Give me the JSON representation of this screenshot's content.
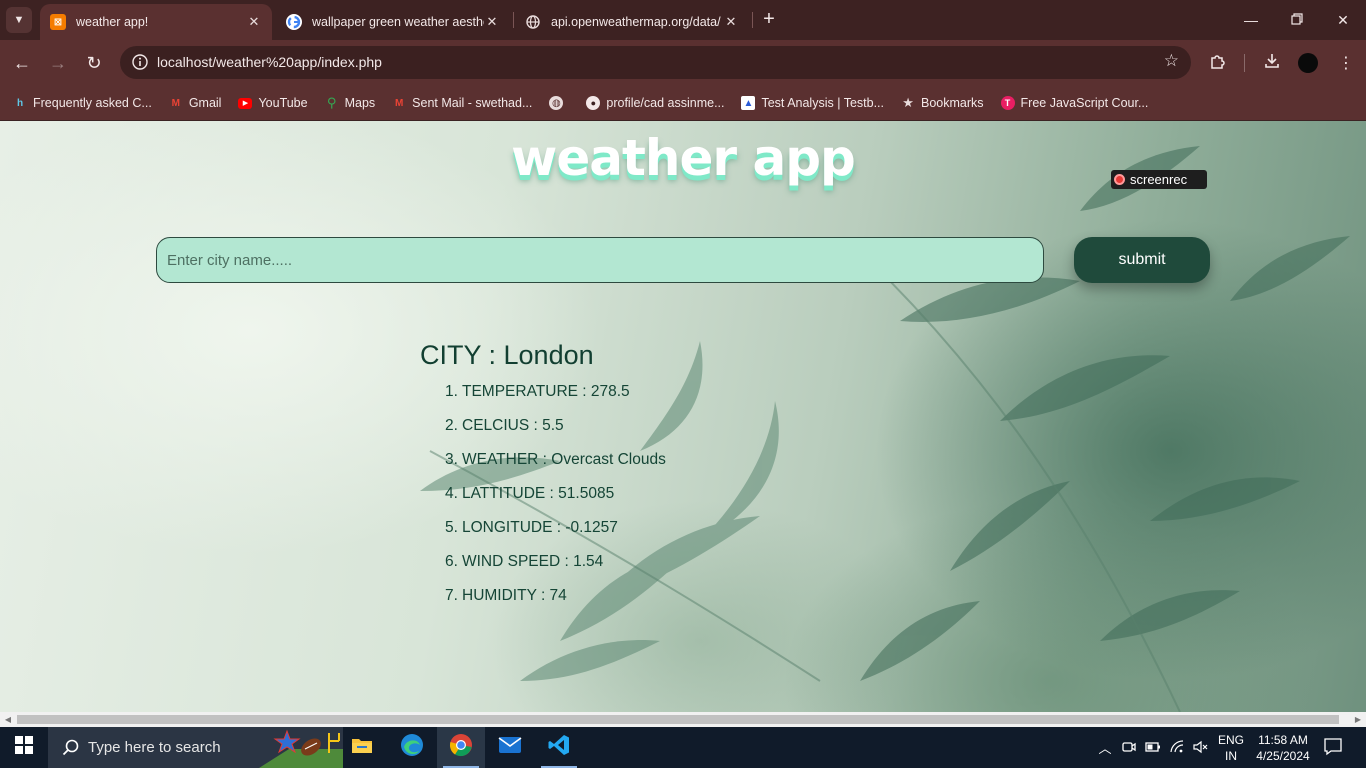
{
  "browser": {
    "tabs": [
      {
        "title": "weather app!",
        "close": "✕"
      },
      {
        "title": "wallpaper green weather aesthe",
        "close": "✕"
      },
      {
        "title": "api.openweathermap.org/data/",
        "close": "✕"
      }
    ],
    "new_tab": "+",
    "address": "localhost/weather%20app/index.php",
    "bookmarks": [
      {
        "label": "Frequently asked C...",
        "icon": "codechef-icon"
      },
      {
        "label": "Gmail",
        "icon": "gmail-icon"
      },
      {
        "label": "YouTube",
        "icon": "youtube-icon"
      },
      {
        "label": "Maps",
        "icon": "maps-icon"
      },
      {
        "label": "Sent Mail - swethad...",
        "icon": "gmail-icon"
      },
      {
        "label": "",
        "icon": "globe-icon"
      },
      {
        "label": "profile/cad assinme...",
        "icon": "github-icon"
      },
      {
        "label": "Test Analysis | Testb...",
        "icon": "testbook-icon"
      },
      {
        "label": "Bookmarks",
        "icon": "star-icon"
      },
      {
        "label": "Free JavaScript Cour...",
        "icon": "javascript-course-icon"
      }
    ]
  },
  "app": {
    "title": "weather app",
    "badge": "screenrec",
    "search": {
      "placeholder": "Enter city name.....",
      "value": ""
    },
    "submit_label": "submit",
    "city_heading": "CITY : London",
    "details": [
      {
        "num": "1.",
        "text": "TEMPERATURE : 278.5"
      },
      {
        "num": "2.",
        "text": "CELCIUS : 5.5"
      },
      {
        "num": "3.",
        "text": "WEATHER : Overcast Clouds"
      },
      {
        "num": "4.",
        "text": "LATTITUDE : 51.5085"
      },
      {
        "num": "5.",
        "text": "LONGITUDE : -0.1257"
      },
      {
        "num": "6.",
        "text": "WIND SPEED : 1.54"
      },
      {
        "num": "7.",
        "text": "HUMIDITY : 74"
      }
    ]
  },
  "taskbar": {
    "search_placeholder": "Type here to search",
    "lang_line1": "ENG",
    "lang_line2": "IN",
    "time": "11:58 AM",
    "date": "4/25/2024"
  },
  "colors": {
    "title_shadow": "#7fe9c8",
    "input_bg": "#b3e7d2",
    "button_bg": "#1f4a3b",
    "text_dark_green": "#123f31",
    "browser_frame": "#5a3030"
  }
}
